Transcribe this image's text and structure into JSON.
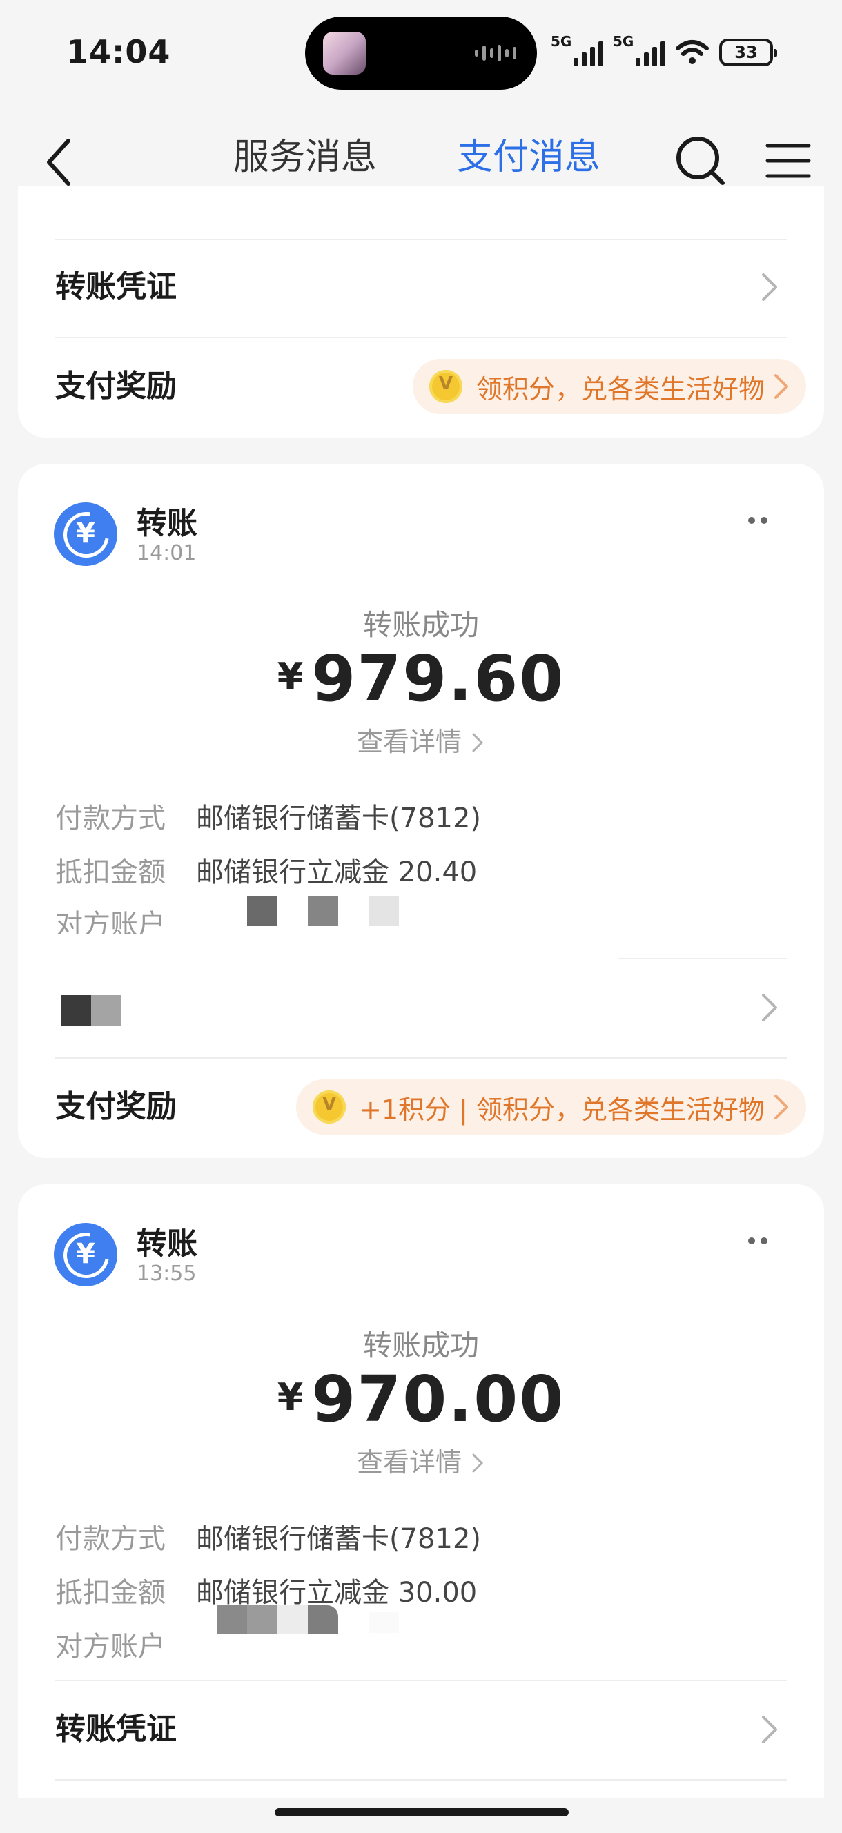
{
  "status_bar": {
    "time": "14:04",
    "signal_1_label": "5G",
    "signal_2_label": "5G",
    "battery": "33"
  },
  "nav": {
    "tab_service": "服务消息",
    "tab_payment": "支付消息",
    "active_tab": "支付消息"
  },
  "top_card": {
    "voucher_label": "转账凭证",
    "reward_label": "支付奖励",
    "reward_pill": "领积分，兑各类生活好物"
  },
  "transfer_1": {
    "title": "转账",
    "time": "14:01",
    "status": "转账成功",
    "currency": "¥",
    "amount": "979.60",
    "detail_link": "查看详情",
    "payment_method_key": "付款方式",
    "payment_method_value": "邮储银行储蓄卡(7812)",
    "deduction_key": "抵扣金额",
    "deduction_value": "邮储银行立减金 20.40",
    "account_key": "对方账户",
    "reward_label": "支付奖励",
    "reward_pill": "+1积分 | 领积分，兑各类生活好物"
  },
  "transfer_2": {
    "title": "转账",
    "time": "13:55",
    "status": "转账成功",
    "currency": "¥",
    "amount": "970.00",
    "detail_link": "查看详情",
    "payment_method_key": "付款方式",
    "payment_method_value": "邮储银行储蓄卡(7812)",
    "deduction_key": "抵扣金额",
    "deduction_value": "邮储银行立减金 30.00",
    "account_key": "对方账户",
    "voucher_label": "转账凭证"
  },
  "colors": {
    "accent": "#2d6fe6",
    "reward_text": "#e0762a",
    "reward_bg": "#fdf0e6",
    "icon_blue": "#3f7fef"
  },
  "icons": {
    "back": "chevron-left-icon",
    "search": "search-icon",
    "menu": "hamburger-menu-icon",
    "transfer": "yen-transfer-icon",
    "more": "more-dots-icon",
    "coin": "points-coin-icon",
    "row_chevron": "chevron-right-icon"
  }
}
